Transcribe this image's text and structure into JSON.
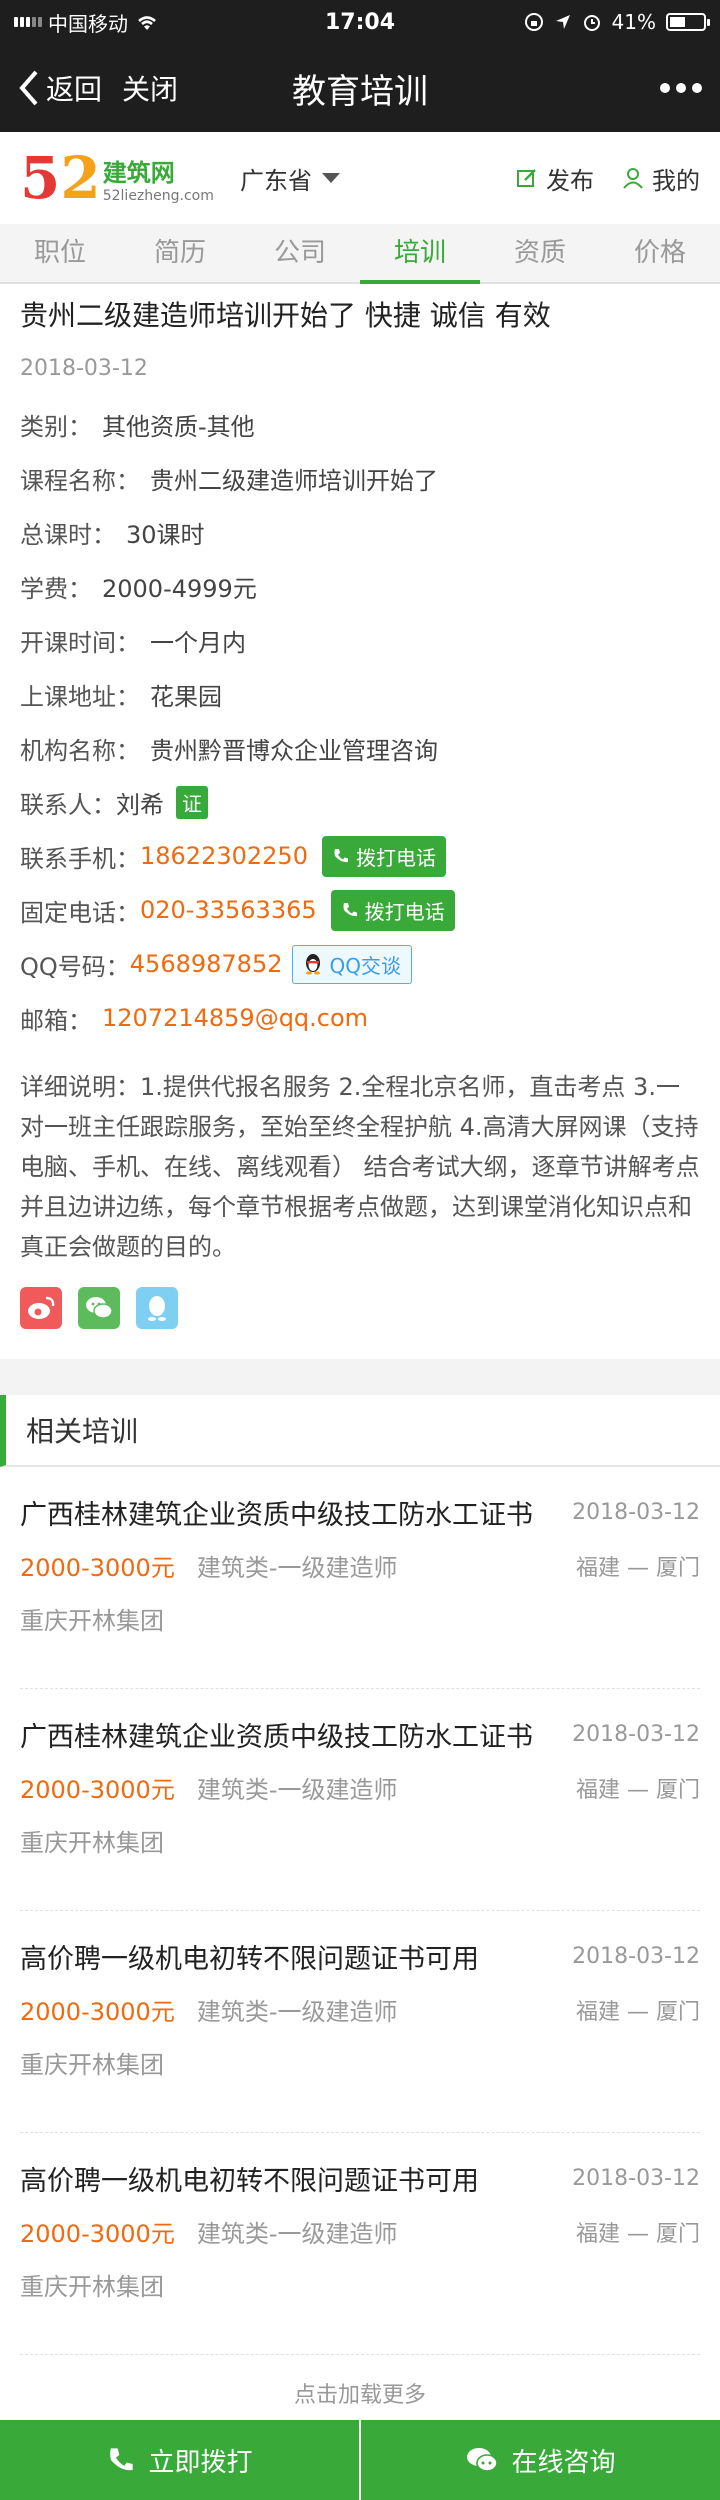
{
  "status_bar": {
    "carrier": "中国移动",
    "time": "17:04",
    "battery": "41%"
  },
  "nav": {
    "back_label": "返回",
    "close_label": "关闭",
    "title": "教育培训"
  },
  "header": {
    "logo_num_1": "5",
    "logo_num_2": "2",
    "logo_cn": "建筑网",
    "logo_en": "52liezheng.com",
    "province": "广东省",
    "publish_label": "发布",
    "mine_label": "我的"
  },
  "tabs": [
    {
      "label": "职位"
    },
    {
      "label": "简历"
    },
    {
      "label": "公司"
    },
    {
      "label": "培训"
    },
    {
      "label": "资质"
    },
    {
      "label": "价格"
    }
  ],
  "detail": {
    "headline": "贵州二级建造师培训开始了 快捷 诚信 有效",
    "date": "2018-03-12",
    "category_label": "类别：",
    "category": "其他资质-其他",
    "course_label": "课程名称：",
    "course": "贵州二级建造师培训开始了",
    "hours_label": "总课时：",
    "hours": "30课时",
    "fee_label": "学费：",
    "fee": "2000-4999元",
    "start_label": "开课时间：",
    "start": "一个月内",
    "address_label": "上课地址：",
    "address": "花果园",
    "org_label": "机构名称：",
    "org": "贵州黔晋博众企业管理咨询",
    "contact_label": "联系人：",
    "contact": "刘希",
    "cert_badge": "证",
    "mobile_label": "联系手机：",
    "mobile": "18622302250",
    "call_label": "拨打电话",
    "phone_label": "固定电话：",
    "phone": "020-33563365",
    "qq_label": "QQ号码：",
    "qq": "4568987852",
    "qq_btn": "QQ交谈",
    "email_label": "邮箱：",
    "email": "1207214859@qq.com",
    "description": "详细说明：1.提供代报名服务 2.全程北京名师，直击考点 3.一对一班主任跟踪服务，至始至终全程护航 4.高清大屏网课（支持电脑、手机、在线、离线观看） 结合考试大纲，逐章节讲解考点并且边讲边练，每个章节根据考点做题，达到课堂消化知识点和真正会做题的目的。"
  },
  "related": {
    "title": "相关培训",
    "items": [
      {
        "title": "广西桂林建筑企业资质中级技工防水工证书",
        "date": "2018-03-12",
        "price": "2000-3000元",
        "category": "建筑类-一级建造师",
        "location": "福建 — 厦门",
        "org": "重庆开林集团"
      },
      {
        "title": "广西桂林建筑企业资质中级技工防水工证书",
        "date": "2018-03-12",
        "price": "2000-3000元",
        "category": "建筑类-一级建造师",
        "location": "福建 — 厦门",
        "org": "重庆开林集团"
      },
      {
        "title": "高价聘一级机电初转不限问题证书可用",
        "date": "2018-03-12",
        "price": "2000-3000元",
        "category": "建筑类-一级建造师",
        "location": "福建 — 厦门",
        "org": "重庆开林集团"
      },
      {
        "title": "高价聘一级机电初转不限问题证书可用",
        "date": "2018-03-12",
        "price": "2000-3000元",
        "category": "建筑类-一级建造师",
        "location": "福建 — 厦门",
        "org": "重庆开林集团"
      }
    ],
    "load_more": "点击加载更多"
  },
  "bottom": {
    "call_label": "立即拨打",
    "consult_label": "在线咨询"
  },
  "colors": {
    "accent": "#39a93a",
    "price": "#f06a0f",
    "dark": "#1e1e1e"
  }
}
